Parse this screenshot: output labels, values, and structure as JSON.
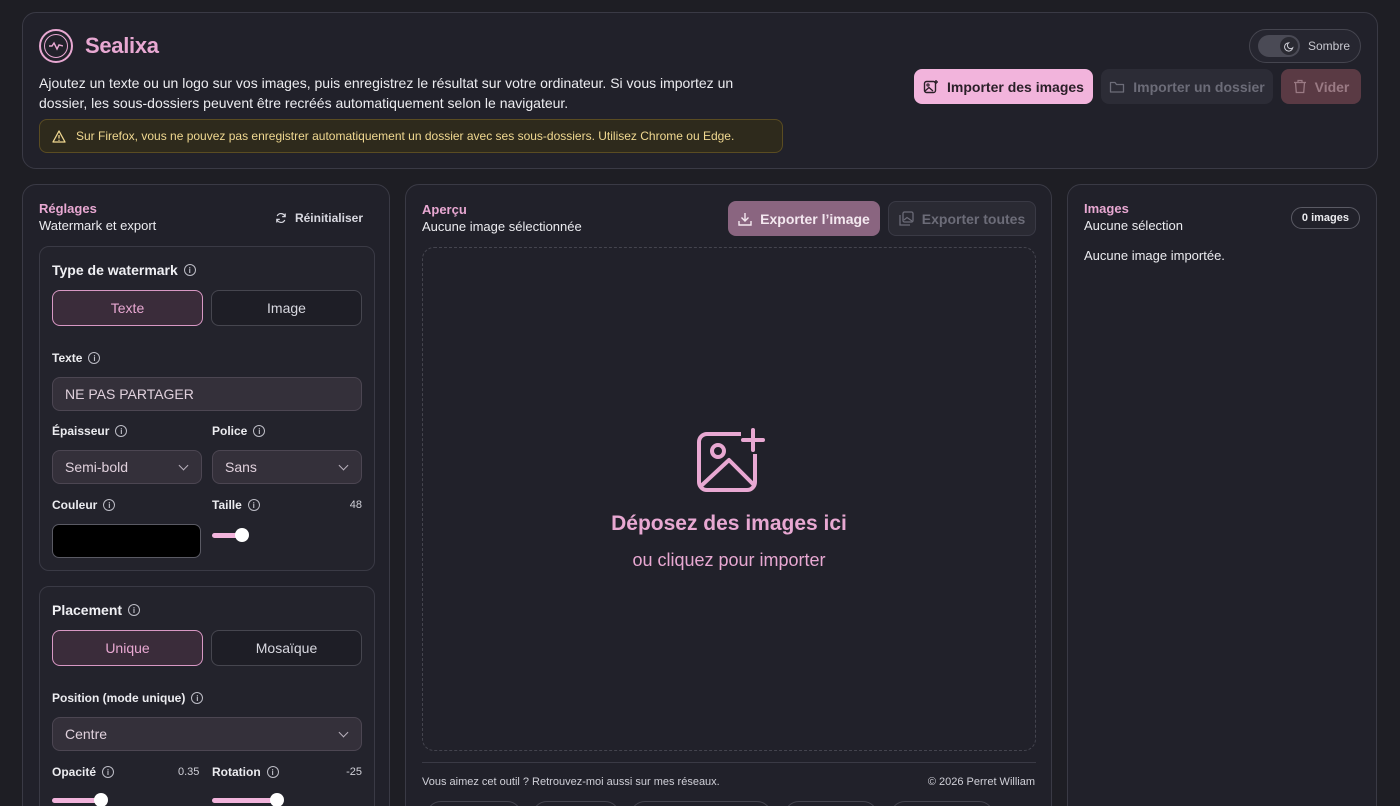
{
  "app": {
    "name": "Sealixa",
    "intro": "Ajoutez un texte ou un logo sur vos images, puis enregistrez le résultat sur votre ordinateur. Si vous importez un dossier, les sous-dossiers peuvent être recréés automatiquement selon le navigateur.",
    "warning": "Sur Firefox, vous ne pouvez pas enregistrer automatiquement un dossier avec ses sous-dossiers. Utilisez Chrome ou Edge.",
    "theme_label": "Sombre"
  },
  "header_buttons": {
    "import_images": "Importer des images",
    "import_folder": "Importer un dossier",
    "clear": "Vider"
  },
  "settings": {
    "title": "Réglages",
    "subtitle": "Watermark et export",
    "reset": "Réinitialiser",
    "watermark_type": {
      "title": "Type de watermark",
      "options": [
        "Texte",
        "Image"
      ],
      "selected": "Texte"
    },
    "text_label": "Texte",
    "text_value": "NE PAS PARTAGER",
    "weight_label": "Épaisseur",
    "weight_value": "Semi-bold",
    "font_label": "Police",
    "font_value": "Sans",
    "color_label": "Couleur",
    "color_value": "#000000",
    "size_label": "Taille",
    "size_value": "48",
    "placement": {
      "title": "Placement",
      "options": [
        "Unique",
        "Mosaïque"
      ],
      "selected": "Unique"
    },
    "position_label": "Position (mode unique)",
    "position_value": "Centre",
    "opacity_label": "Opacité",
    "opacity_value": "0.35",
    "rotation_label": "Rotation",
    "rotation_value": "-25"
  },
  "preview": {
    "title": "Aperçu",
    "subtitle": "Aucune image sélectionnée",
    "export_one": "Exporter l’image",
    "export_all": "Exporter toutes",
    "drop_title": "Déposez des images ici",
    "drop_sub": "ou cliquez pour importer",
    "footer_left": "Vous aimez cet outil ? Retrouvez-moi aussi sur mes réseaux.",
    "footer_right": "© 2026 Perret William"
  },
  "images": {
    "title": "Images",
    "subtitle": "Aucune sélection",
    "count": "0 images",
    "empty": "Aucune image importée."
  },
  "colors": {
    "accent": "#e8a8d2",
    "accent_button": "#f2b4dc",
    "background": "#1e1e24",
    "panel": "#21212a"
  }
}
